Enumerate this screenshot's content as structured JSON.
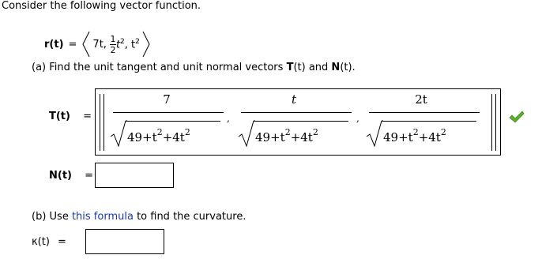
{
  "intro": "Consider the following vector function.",
  "vector_function": {
    "label": "r(t)",
    "equals": "=",
    "components": [
      "7t,",
      "1",
      "2",
      "t",
      "2",
      ", t",
      "2"
    ]
  },
  "part_a": {
    "prefix": "(a) Find the unit tangent and unit normal vectors ",
    "T": "T",
    "t1": "(t)",
    "and": " and ",
    "N": "N",
    "t2": "(t).",
    "T_label": "T(t)",
    "eq": "=",
    "T_answer": [
      {
        "numerator": "7",
        "den_a": "49+t",
        "den_b": "+4t",
        "exp": "2"
      },
      {
        "numerator": "t",
        "den_a": "49+t",
        "den_b": "+4t",
        "exp": "2"
      },
      {
        "numerator": "2t",
        "den_a": "49+t",
        "den_b": "+4t",
        "exp": "2"
      }
    ],
    "separator": ",",
    "N_label": "N(t)",
    "N_value": ""
  },
  "part_b": {
    "prefix": "(b) Use ",
    "link": "this formula",
    "suffix": " to find the curvature.",
    "kappa_label": "κ(t)",
    "eq": "=",
    "kappa_value": ""
  },
  "status": {
    "icon": "checkmark-icon",
    "color": "#5cb030"
  }
}
